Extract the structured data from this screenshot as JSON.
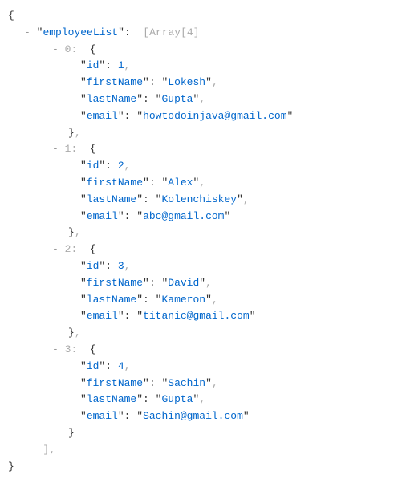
{
  "root_key": "employeeList",
  "array_meta": "Array[4]",
  "keys": {
    "id": "id",
    "firstName": "firstName",
    "lastName": "lastName",
    "email": "email"
  },
  "toggle_symbol": "-",
  "indices": [
    "0",
    "1",
    "2",
    "3"
  ],
  "employees": [
    {
      "id": 1,
      "firstName": "Lokesh",
      "lastName": "Gupta",
      "email": "howtodoinjava@gmail.com"
    },
    {
      "id": 2,
      "firstName": "Alex",
      "lastName": "Kolenchiskey",
      "email": "abc@gmail.com"
    },
    {
      "id": 3,
      "firstName": "David",
      "lastName": "Kameron",
      "email": "titanic@gmail.com"
    },
    {
      "id": 4,
      "firstName": "Sachin",
      "lastName": "Gupta",
      "email": "Sachin@gmail.com"
    }
  ]
}
